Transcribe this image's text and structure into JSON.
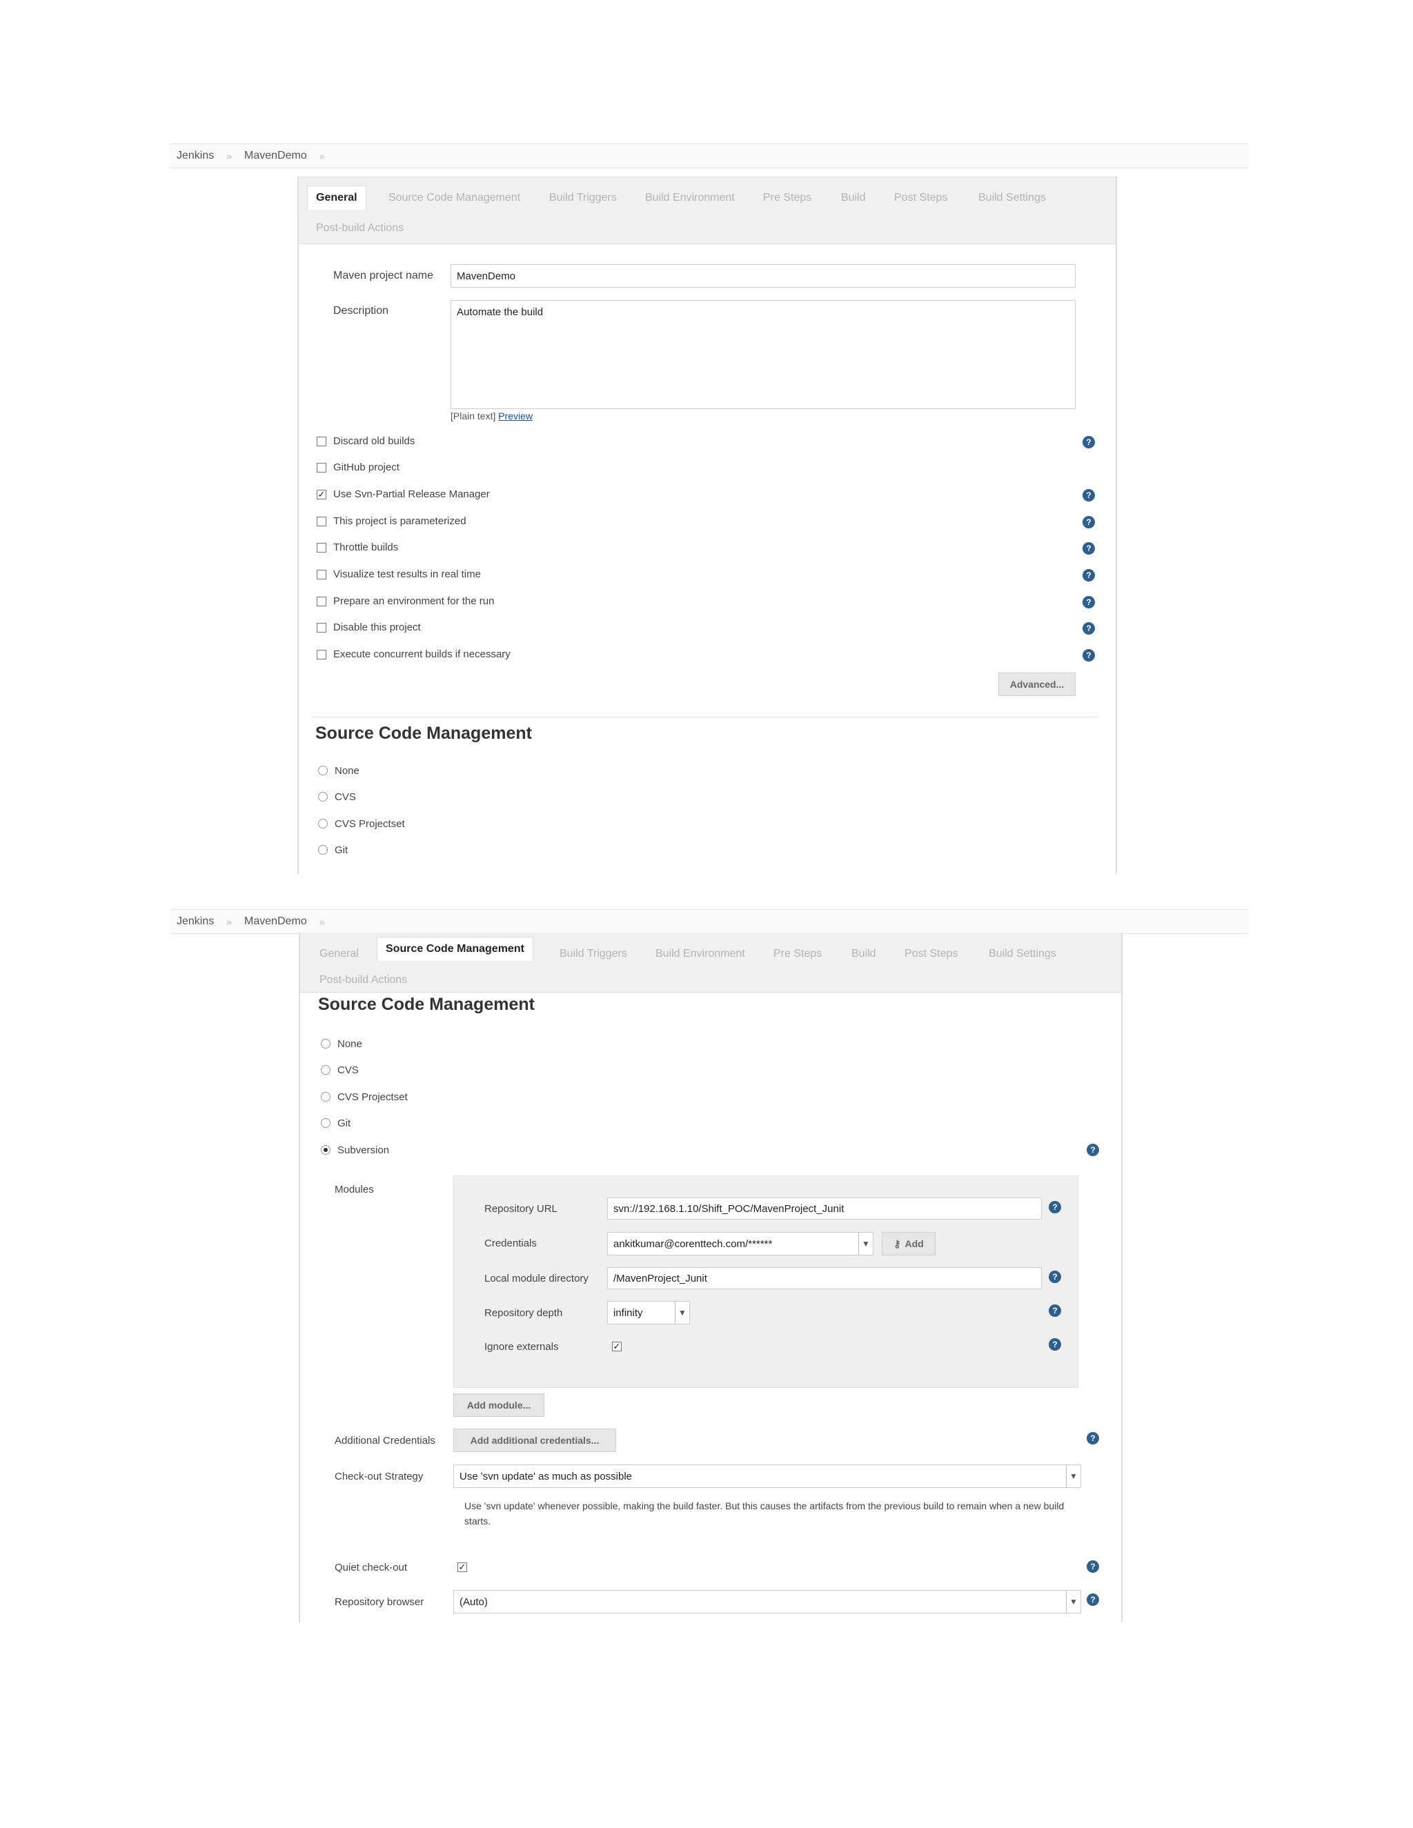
{
  "breadcrumb": {
    "root": "Jenkins",
    "project": "MavenDemo",
    "separator": "»",
    "arrow": "»"
  },
  "tabs": [
    "General",
    "Source Code Management",
    "Build Triggers",
    "Build Environment",
    "Pre Steps",
    "Build",
    "Post Steps",
    "Build Settings",
    "Post-build Actions"
  ],
  "general": {
    "project_name_label": "Maven project name",
    "project_name_value": "MavenDemo",
    "description_label": "Description",
    "description_value": "Automate the build",
    "plain_text": "[Plain text]",
    "preview_link": "Preview",
    "options": [
      {
        "label": "Discard old builds",
        "checked": false
      },
      {
        "label": "GitHub project",
        "checked": false
      },
      {
        "label": "Use Svn-Partial Release Manager",
        "checked": true
      },
      {
        "label": "This project is parameterized",
        "checked": false
      },
      {
        "label": "Throttle builds",
        "checked": false
      },
      {
        "label": "Visualize test results in real time",
        "checked": false
      },
      {
        "label": "Prepare an environment for the run",
        "checked": false
      },
      {
        "label": "Disable this project",
        "checked": false
      },
      {
        "label": "Execute concurrent builds if necessary",
        "checked": false
      }
    ],
    "advanced_button": "Advanced..."
  },
  "scm": {
    "title": "Source Code Management",
    "options_first": [
      "None",
      "CVS",
      "CVS Projectset",
      "Git"
    ],
    "options_second": [
      "None",
      "CVS",
      "CVS Projectset",
      "Git",
      "Subversion"
    ],
    "selected": "Subversion",
    "modules_label": "Modules",
    "repo_url_label": "Repository URL",
    "repo_url_value": "svn://192.168.1.10/Shift_POC/MavenProject_Junit",
    "credentials_label": "Credentials",
    "credentials_value": "ankitkumar@corenttech.com/******",
    "add_button": "Add",
    "local_dir_label": "Local module directory",
    "local_dir_value": "/MavenProject_Junit",
    "depth_label": "Repository depth",
    "depth_value": "infinity",
    "ignore_label": "Ignore externals",
    "ignore_checked": true,
    "add_module_button": "Add module...",
    "additional_credentials_label": "Additional Credentials",
    "add_additional_credentials_button": "Add additional credentials...",
    "checkout_label": "Check-out Strategy",
    "checkout_value": "Use 'svn update' as much as possible",
    "checkout_hint": "Use 'svn update' whenever possible, making the build faster. But this causes the artifacts from the previous build to remain when a new build starts.",
    "quiet_label": "Quiet check-out",
    "quiet_checked": true,
    "browser_label": "Repository browser",
    "browser_value": "(Auto)"
  },
  "colors": {
    "help_icon": "#2e5f8f",
    "tab_bar": "#f0f0f0",
    "module_box": "#efefef"
  }
}
